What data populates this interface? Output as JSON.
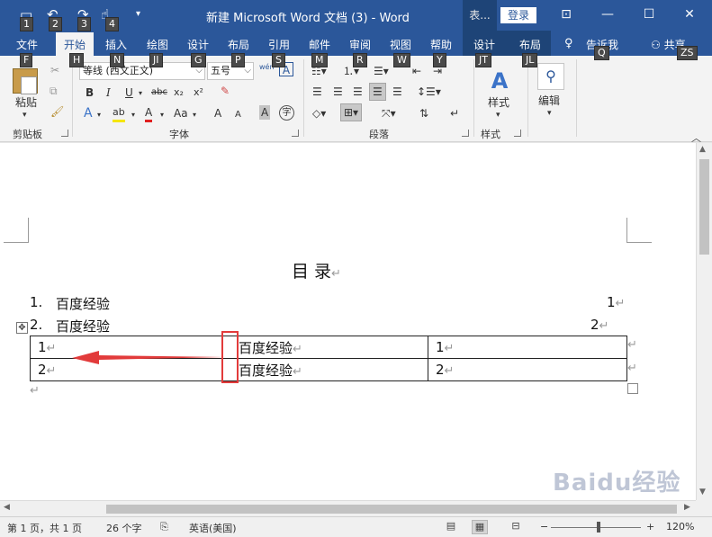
{
  "qat": {
    "save_key": "1",
    "undo_key": "2",
    "redo_key": "3",
    "touch_key": "4",
    "save_icon": "save-icon",
    "undo_icon": "undo-icon",
    "redo_icon": "redo-icon",
    "touch_icon": "touch-mode-icon",
    "customize_icon": "customize-qat-icon"
  },
  "title": "新建 Microsoft Word 文档 (3)  -  Word",
  "context_tab_label": "表...",
  "login_label": "登录",
  "window": {
    "ribbon_opts_icon": "ribbon-display-options-icon",
    "min_icon": "minimize-icon",
    "max_icon": "maximize-icon",
    "close_icon": "close-icon"
  },
  "tabs": [
    {
      "label": "文件",
      "key": "F"
    },
    {
      "label": "开始",
      "key": "H"
    },
    {
      "label": "插入",
      "key": "N"
    },
    {
      "label": "绘图",
      "key": "JI"
    },
    {
      "label": "设计",
      "key": "G"
    },
    {
      "label": "布局",
      "key": "P"
    },
    {
      "label": "引用",
      "key": "S"
    },
    {
      "label": "邮件",
      "key": "M"
    },
    {
      "label": "审阅",
      "key": "R"
    },
    {
      "label": "视图",
      "key": "W"
    },
    {
      "label": "帮助",
      "key": "Y"
    },
    {
      "label": "设计",
      "key": "JT"
    },
    {
      "label": "布局",
      "key": "JL"
    },
    {
      "label": "告诉我",
      "key": "Q"
    },
    {
      "label": "共享",
      "key": "ZS"
    }
  ],
  "ribbon": {
    "clipboard": {
      "paste_label": "粘贴",
      "group_label": "剪贴板"
    },
    "font": {
      "font_name": "等线 (西文正文)",
      "font_size": "五号",
      "phonetic_label": "wén",
      "char_border_label": "A",
      "bold": "B",
      "italic": "I",
      "underline": "U",
      "strike": "abc",
      "subscript": "x₂",
      "superscript": "x²",
      "text_effect": "A",
      "highlight": "ab",
      "font_color": "A",
      "change_case": "Aa",
      "grow": "A",
      "shrink": "A",
      "char_shading": "A",
      "enclose": "字",
      "group_label": "字体"
    },
    "paragraph": {
      "group_label": "段落"
    },
    "styles": {
      "label": "样式",
      "group_label": "样式"
    },
    "editing": {
      "label": "编辑"
    }
  },
  "document": {
    "title": "目        录",
    "toc": [
      {
        "num": "1.",
        "text": "百度经验",
        "page": "1"
      },
      {
        "num": "2.",
        "text": "百度经验",
        "page": "2"
      }
    ],
    "table": [
      [
        "1",
        "百度经验",
        "1"
      ],
      [
        "2",
        "百度经验",
        "2"
      ]
    ],
    "para_mark": "↵",
    "watermark": "Baidu经验"
  },
  "status": {
    "page": "第 1 页，共 1 页",
    "words": "26 个字",
    "language": "英语(美国)",
    "zoom": "120%",
    "zoom_minus": "−",
    "zoom_plus": "+"
  },
  "colors": {
    "title_bar": "#2b579a",
    "context_tab": "#1e4477",
    "highlight_box": "#e23b3b",
    "arrow": "#e23b3b"
  }
}
